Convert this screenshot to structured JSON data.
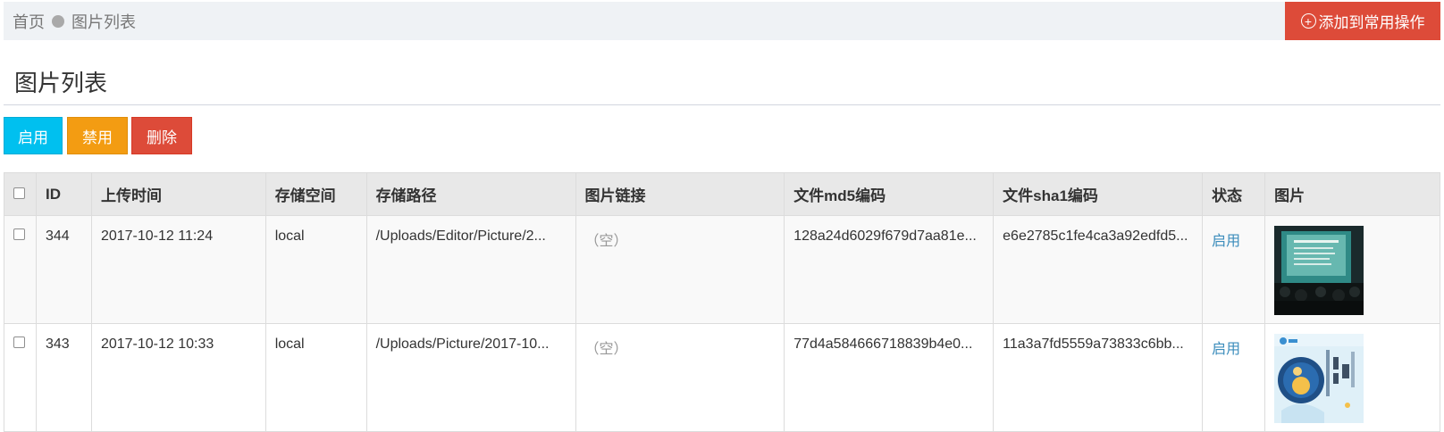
{
  "breadcrumb": {
    "home": "首页",
    "current": "图片列表"
  },
  "header": {
    "add_button": "添加到常用操作",
    "plus_glyph": "+"
  },
  "page": {
    "title": "图片列表"
  },
  "toolbar": {
    "enable": "启用",
    "disable": "禁用",
    "delete": "删除"
  },
  "table": {
    "columns": [
      "",
      "ID",
      "上传时间",
      "存储空间",
      "存储路径",
      "图片链接",
      "文件md5编码",
      "文件sha1编码",
      "状态",
      "图片"
    ],
    "rows": [
      {
        "id": "344",
        "time": "2017-10-12 11:24",
        "storage": "local",
        "path": "/Uploads/Editor/Picture/2...",
        "link": "（空）",
        "md5": "128a24d6029f679d7aa81e...",
        "sha1": "e6e2785c1fe4ca3a92edfd5...",
        "status": "启用",
        "image_icon": "photo-thumbnail-presentation"
      },
      {
        "id": "343",
        "time": "2017-10-12 10:33",
        "storage": "local",
        "path": "/Uploads/Picture/2017-10...",
        "link": "（空）",
        "md5": "77d4a584666718839b4e0...",
        "sha1": "11a3a7fd5559a73833c6bb...",
        "status": "启用",
        "image_icon": "photo-thumbnail-midautumn-poster"
      }
    ]
  },
  "colors": {
    "danger": "#dd4b39",
    "info": "#00c0ef",
    "warning": "#f39c12",
    "link": "#3c8dbc"
  }
}
